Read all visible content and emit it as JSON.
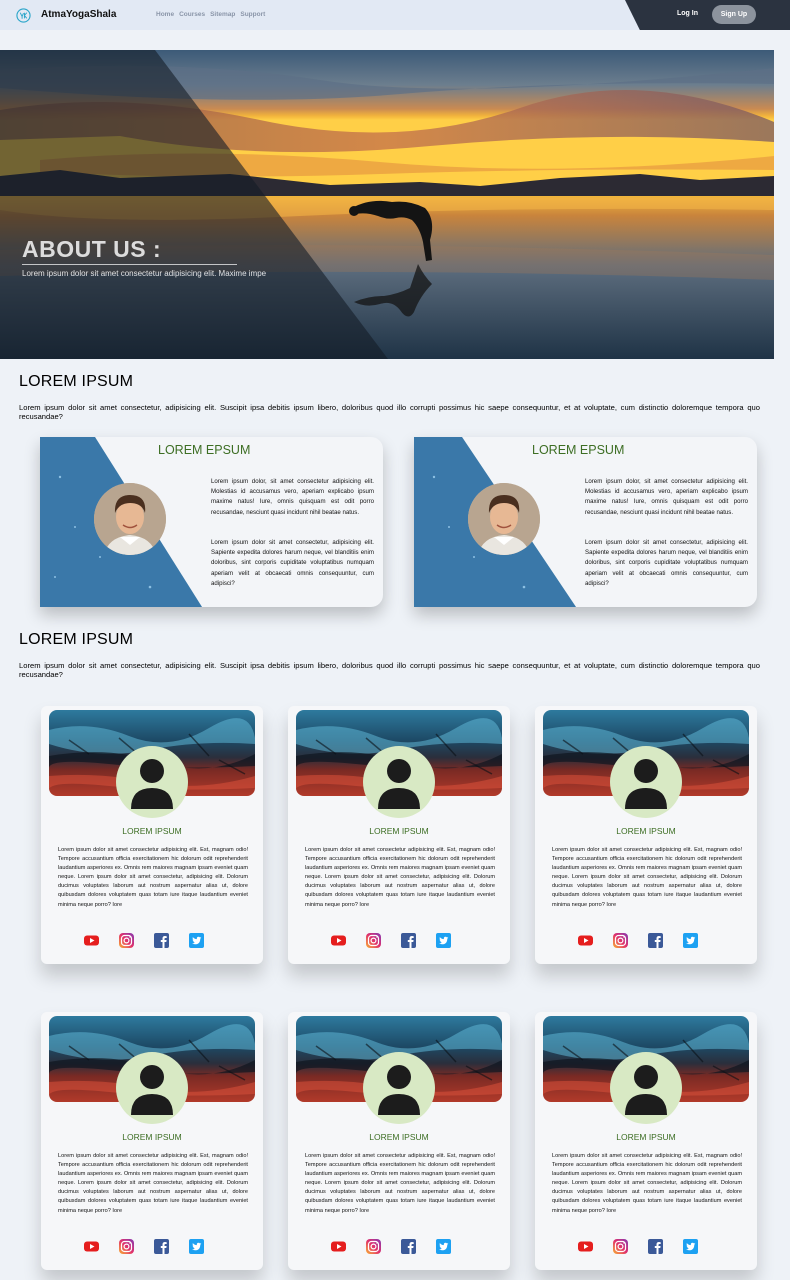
{
  "nav": {
    "brand": "AtmaYogaShala",
    "links": [
      "Home",
      "Courses",
      "Sitemap",
      "Support"
    ],
    "login": "Log In",
    "signup": "Sign Up"
  },
  "hero": {
    "title": "ABOUT US :",
    "subtitle": "Lorem ipsum dolor sit amet consectetur adipisicing elit. Maxime impe"
  },
  "section1": {
    "title": "LOREM IPSUM",
    "text": "Lorem ipsum dolor sit amet consectetur, adipisicing elit. Suscipit ipsa debitis ipsum libero, doloribus quod illo corrupti possimus hic saepe consequuntur, et at voluptate, cum distinctio doloremque tempora quo recusandae?"
  },
  "about_cards": [
    {
      "title": "LOREM EPSUM",
      "para1": "Lorem ipsum dolor, sit amet consectetur adipisicing elit. Molestias id accusamus vero, aperiam explicabo ipsum maxime natus! Iure, omnis quisquam est odit porro recusandae, nesciunt quasi incidunt nihil beatae natus.",
      "para2": "Lorem ipsum dolor sit amet consectetur, adipisicing elit. Sapiente expedita dolores harum neque, vel blanditiis enim doloribus, sint corporis cupiditate voluptatibus numquam aperiam velit at obcaecati omnis consequuntur, cum adipisci?"
    },
    {
      "title": "LOREM EPSUM",
      "para1": "Lorem ipsum dolor, sit amet consectetur adipisicing elit. Molestias id accusamus vero, aperiam explicabo ipsum maxime natus! Iure, omnis quisquam est odit porro recusandae, nesciunt quasi incidunt nihil beatae natus.",
      "para2": "Lorem ipsum dolor sit amet consectetur, adipisicing elit. Sapiente expedita dolores harum neque, vel blanditiis enim doloribus, sint corporis cupiditate voluptatibus numquam aperiam velit at obcaecati omnis consequuntur, cum adipisci?"
    }
  ],
  "section2": {
    "title": "LOREM IPSUM",
    "text": "Lorem ipsum dolor sit amet consectetur, adipisicing elit. Suscipit ipsa debitis ipsum libero, doloribus quod illo corrupti possimus hic saepe consequuntur, et at voluptate, cum distinctio doloremque tempora quo recusandae?"
  },
  "team_cards": [
    {
      "name": "LOREM IPSUM",
      "text": "Lorem ipsum dolor sit amet consectetur adipisicing elit. Est, magnam odio! Tempore accusantium officia exercitationem hic dolorum odit reprehenderit laudantium asperiores ex. Omnis rem maiores magnam ipsam eveniet quam neque. Lorem ipsum dolor sit amet consectetur, adipisicing elit. Dolorum ducimus voluptates laborum aut nostrum aspernatur alias ut, dolore quibusdam dolores voluptatem quas totam iure itaque laudantium eveniet minima neque porro? Iore"
    },
    {
      "name": "LOREM IPSUM",
      "text": "Lorem ipsum dolor sit amet consectetur adipisicing elit. Est, magnam odio! Tempore accusantium officia exercitationem hic dolorum odit reprehenderit laudantium asperiores ex. Omnis rem maiores magnam ipsam eveniet quam neque. Lorem ipsum dolor sit amet consectetur, adipisicing elit. Dolorum ducimus voluptates laborum aut nostrum aspernatur alias ut, dolore quibusdam dolores voluptatem quas totam iure itaque laudantium eveniet minima neque porro? Iore"
    },
    {
      "name": "LOREM IPSUM",
      "text": "Lorem ipsum dolor sit amet consectetur adipisicing elit. Est, magnam odio! Tempore accusantium officia exercitationem hic dolorum odit reprehenderit laudantium asperiores ex. Omnis rem maiores magnam ipsam eveniet quam neque. Lorem ipsum dolor sit amet consectetur, adipisicing elit. Dolorum ducimus voluptates laborum aut nostrum aspernatur alias ut, dolore quibusdam dolores voluptatem quas totam iure itaque laudantium eveniet minima neque porro? Iore"
    },
    {
      "name": "LOREM IPSUM",
      "text": "Lorem ipsum dolor sit amet consectetur adipisicing elit. Est, magnam odio! Tempore accusantium officia exercitationem hic dolorum odit reprehenderit laudantium asperiores ex. Omnis rem maiores magnam ipsam eveniet quam neque. Lorem ipsum dolor sit amet consectetur, adipisicing elit. Dolorum ducimus voluptates laborum aut nostrum aspernatur alias ut, dolore quibusdam dolores voluptatem quas totam iure itaque laudantium eveniet minima neque porro? Iore"
    },
    {
      "name": "LOREM IPSUM",
      "text": "Lorem ipsum dolor sit amet consectetur adipisicing elit. Est, magnam odio! Tempore accusantium officia exercitationem hic dolorum odit reprehenderit laudantium asperiores ex. Omnis rem maiores magnam ipsam eveniet quam neque. Lorem ipsum dolor sit amet consectetur, adipisicing elit. Dolorum ducimus voluptates laborum aut nostrum aspernatur alias ut, dolore quibusdam dolores voluptatem quas totam iure itaque laudantium eveniet minima neque porro? Iore"
    },
    {
      "name": "LOREM IPSUM",
      "text": "Lorem ipsum dolor sit amet consectetur adipisicing elit. Est, magnam odio! Tempore accusantium officia exercitationem hic dolorum odit reprehenderit laudantium asperiores ex. Omnis rem maiores magnam ipsam eveniet quam neque. Lorem ipsum dolor sit amet consectetur, adipisicing elit. Dolorum ducimus voluptates laborum aut nostrum aspernatur alias ut, dolore quibusdam dolores voluptatem quas totam iure itaque laudantium eveniet minima neque porro? Iore"
    }
  ],
  "social_icons": [
    "youtube-icon",
    "instagram-icon",
    "facebook-icon",
    "twitter-icon"
  ],
  "colors": {
    "accent_green": "#3d6e24",
    "nav_dark": "#2b3340",
    "card_blue": "#3f7fb0",
    "avatar_bg": "#d8e9c4"
  }
}
